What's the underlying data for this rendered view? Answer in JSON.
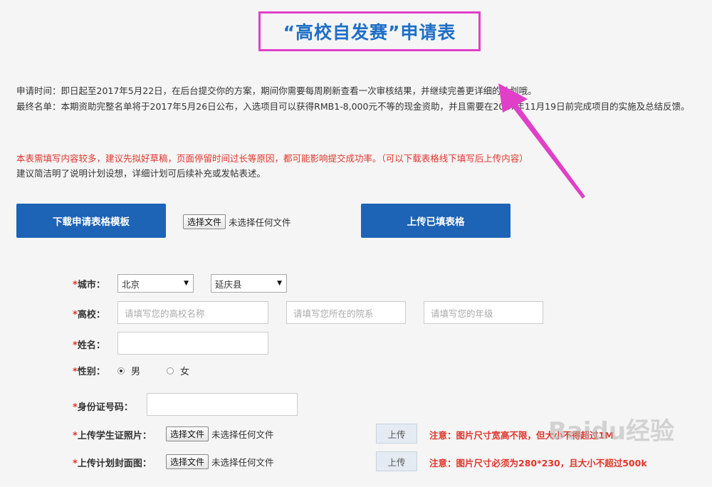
{
  "header": {
    "title": "“高校自发赛”申请表"
  },
  "info": {
    "line1": "申请时间：即日起至2017年5月22日，在后台提交你的方案，期间你需要每周刷新查看一次审核结果，并继续完善更详细的计划哦。",
    "line2": "最终名单：本期资助完整名单将于2017年5月26日公布，入选项目可以获得RMB1-8,000元不等的现金资助，并且需要在2017年11月19日前完成项目的实施及总结反馈。"
  },
  "warning": {
    "red": "本表需填写内容较多，建议先拟好草稿，页面停留时间过长等原因，都可能影响提交成功率。（可以下载表格线下填写后上传内容）",
    "grey": "建议简洁明了说明计划设想，详细计划可后续补充或发帖表述。"
  },
  "actions": {
    "download_label": "下载申请表格模板",
    "upload_label": "上传已填表格"
  },
  "file": {
    "choose_label": "选择文件",
    "none_label": "未选择任何文件"
  },
  "form": {
    "star": "*",
    "city_label": "城市：",
    "city_value": "北京",
    "county_value": "延庆县",
    "school_label": "高校：",
    "school_placeholder": "请填写您的高校名称",
    "college_placeholder": "请填写您所在的院系",
    "grade_placeholder": "请填写您的年级",
    "name_label": "姓名：",
    "gender_label": "性别：",
    "gender_male": "男",
    "gender_female": "女",
    "gender_selected": "男",
    "id_label": "身份证号码：",
    "student_photo_label": "上传学生证照片：",
    "cover_label": "上传计划封面图：",
    "upload_btn": "上传",
    "note_photo": "注意：图片尺寸宽高不限，但大小不得超过1M",
    "note_cover": "注意：图片尺寸必须为280*230，且大小不超过500k"
  },
  "colors": {
    "brand_blue": "#1d63b6",
    "title_blue": "#1e6fc7",
    "alert_red": "#e0352b",
    "annotation_magenta": "#e040c8"
  },
  "watermark": "Baidu经验"
}
